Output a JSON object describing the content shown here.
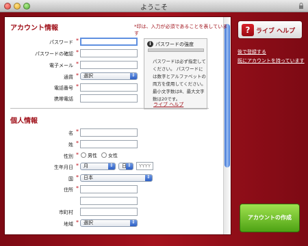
{
  "window": {
    "title": "ようこそ"
  },
  "notice": "*印は、入力が必須であることを表しています",
  "account": {
    "title": "アカウント情報",
    "password_label": "パスワード",
    "password_confirm_label": "パスワードの確認",
    "email_label": "電子メール",
    "currency_label": "通貨",
    "currency_value": "選択",
    "phone_label": "電話番号",
    "mobile_label": "携帯電話"
  },
  "tooltip": {
    "title": "パスワードの強度",
    "text": "パスワードは必ず指定してください。 パスワードには数字とアルファベットの両方を使用してください。最小文字数は8、最大文字数は20です。",
    "link": "ライブ ヘルプ"
  },
  "personal": {
    "title": "個人情報",
    "first_name_label": "名",
    "last_name_label": "姓",
    "gender_label": "性別",
    "male": "男性",
    "female": "女性",
    "birth_label": "生年月日",
    "month_value": "月",
    "day_value": "日",
    "year_placeholder": "YYYY",
    "country_label": "国",
    "country_value": "日本",
    "address_label": "住所",
    "city_label": "市町村",
    "region_label": "地域",
    "region_value": "選択"
  },
  "sidebar": {
    "help_label": "ライブ ヘルプ",
    "help_icon": "?",
    "link_login": "後で登録する",
    "link_have_account": "既にアカウントを持っています",
    "create_button": "アカウントの作成"
  },
  "colors": {
    "accent": "#a0121b",
    "create_button": "#5fb81e"
  }
}
